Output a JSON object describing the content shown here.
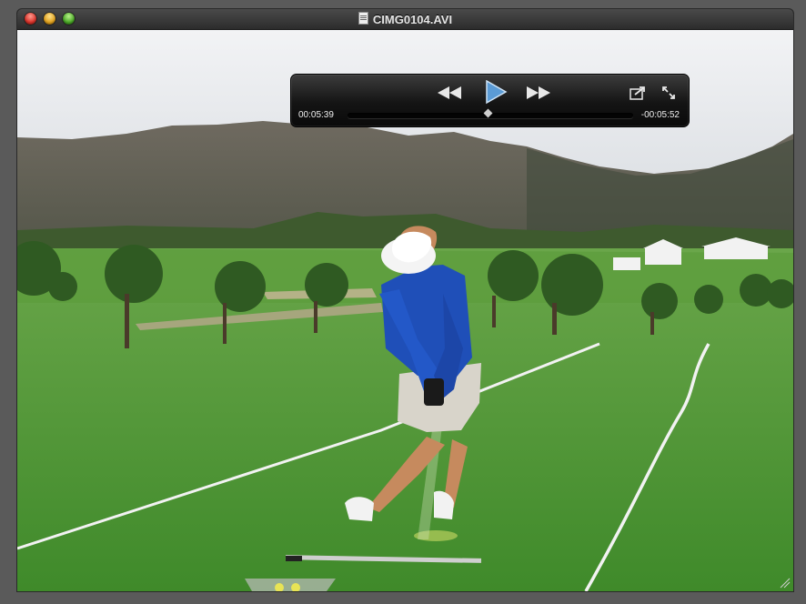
{
  "window": {
    "title": "CIMG0104.AVI"
  },
  "controls": {
    "current_time": "00:05:39",
    "remaining_time": "-00:05:52",
    "playback_fraction": 0.49,
    "rewind_icon": "rewind-icon",
    "play_icon": "play-icon",
    "fast_forward_icon": "fast-forward-icon",
    "share_icon": "share-icon",
    "fullscreen_icon": "fullscreen-icon"
  },
  "colors": {
    "hud_bg": "#141414",
    "play_accent": "#5b9bd5",
    "sky": "#e8eaec",
    "grass": "#4f9a34",
    "shirt": "#1f4fb8"
  }
}
